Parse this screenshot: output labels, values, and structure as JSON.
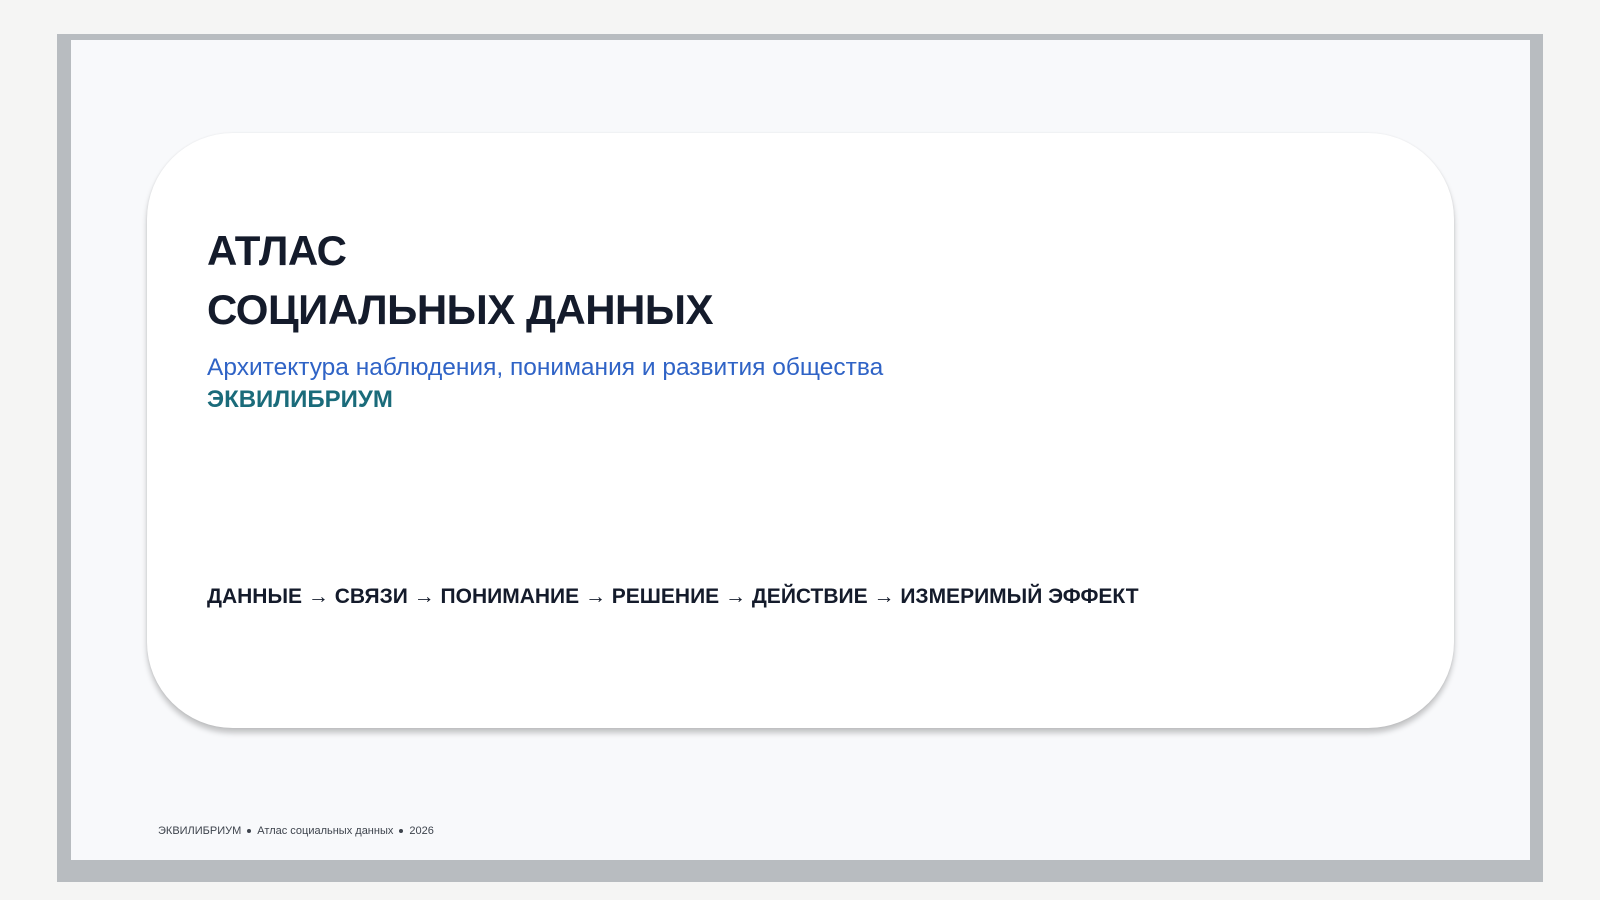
{
  "title": {
    "line1": "АТЛАС",
    "line2": "СОЦИАЛЬНЫХ ДАННЫХ"
  },
  "subtitle": "Архитектура наблюдения, понимания и развития общества",
  "brand": "ЭКВИЛИБРИУМ",
  "flow": "ДАННЫЕ → СВЯЗИ → ПОНИМАНИЕ → РЕШЕНИЕ → ДЕЙСТВИЕ → ИЗМЕРИМЫЙ ЭФФЕКТ",
  "footer": {
    "brand": "ЭКВИЛИБРИУМ",
    "project": "Атлас социальных данных",
    "year": "2026"
  },
  "colors": {
    "title": "#141b2b",
    "subtitle": "#2f63c6",
    "brand": "#1a6b7a",
    "frame": "#b8bcc0"
  }
}
